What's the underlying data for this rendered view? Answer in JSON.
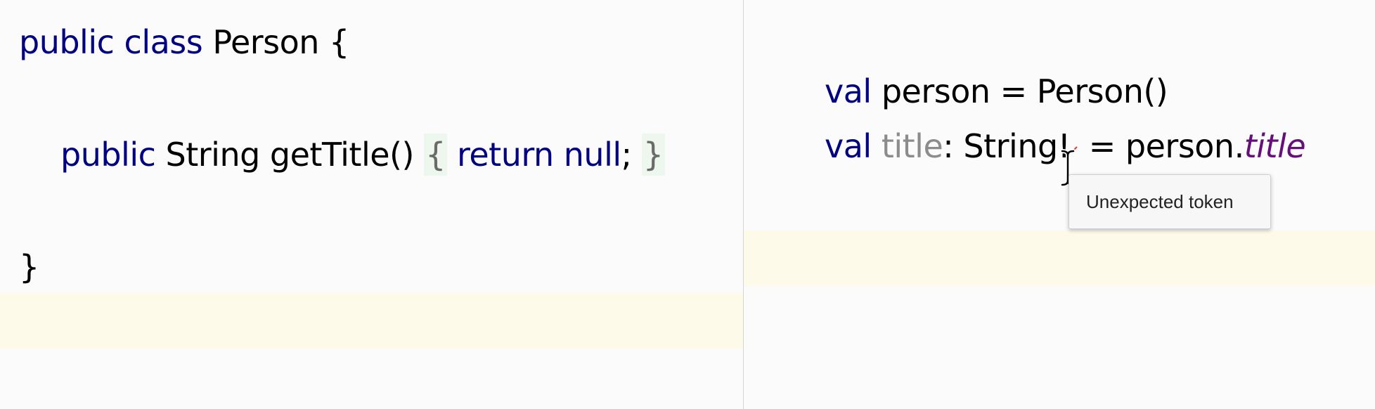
{
  "left_editor": {
    "lines": [
      {
        "keywords": "public class",
        "rest": " Person {"
      },
      {
        "keyword": "public",
        "type_and_method": " String getTitle()",
        "open_brace": "{",
        "return_kw": "return null",
        "semicolon": ";",
        "close_brace": "}"
      },
      {
        "text": "}"
      }
    ]
  },
  "right_editor": {
    "line1": {
      "keyword": "val",
      "rest": " person = Person()"
    },
    "line2": {
      "keyword": "val",
      "var_name": "title",
      "type_part": ": String",
      "typed_char": "!",
      "assign": " = person.",
      "property": "title"
    }
  },
  "tooltip": {
    "text": "Unexpected token"
  },
  "colors": {
    "keyword": "#000080",
    "property": "#660e7a",
    "unused_var": "#8c8c8c",
    "line_highlight": "#fefaea",
    "fold_bg": "#eef7ee",
    "error": "#e53935"
  },
  "icons": {
    "cursor": "text-cursor-icon",
    "error": "error-marker-icon"
  }
}
